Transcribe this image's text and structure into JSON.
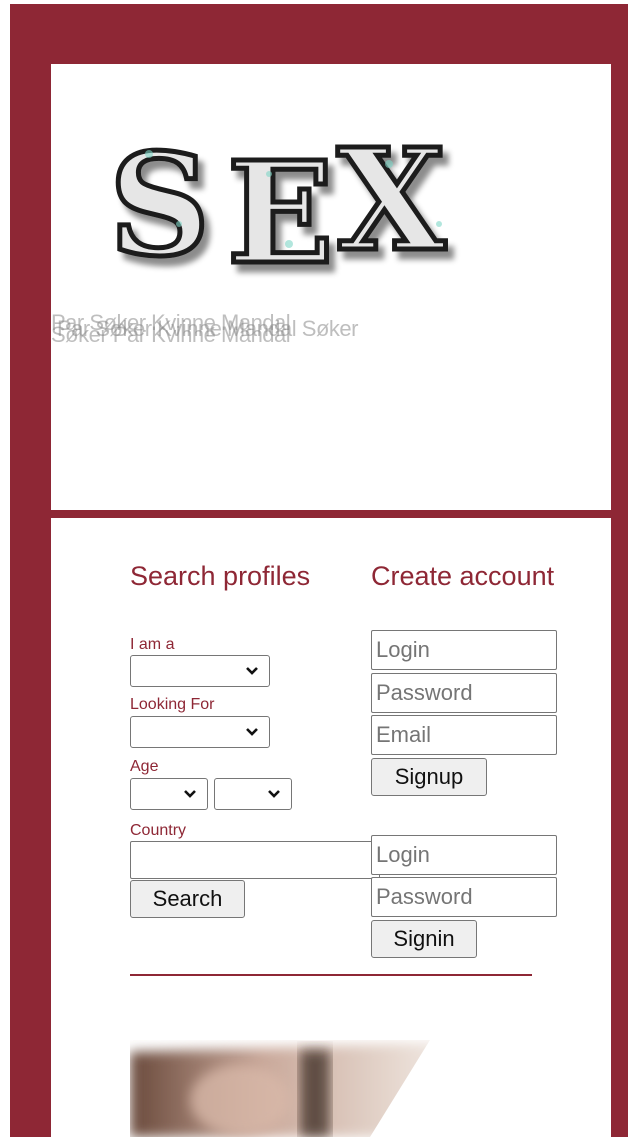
{
  "header": {
    "logo_text": "SEX",
    "ghost_lines": [
      "Par Søker Kvinne Mandal",
      "Søker Par Kvinne Mandal",
      "Par Søker Kvinne Mandal Søker"
    ]
  },
  "search": {
    "title": "Search profiles",
    "i_am_label": "I am a",
    "looking_for_label": "Looking For",
    "age_label": "Age",
    "country_label": "Country",
    "country_value": "",
    "search_button": "Search"
  },
  "create": {
    "title": "Create account",
    "login_placeholder": "Login",
    "password_placeholder": "Password",
    "email_placeholder": "Email",
    "signup_button": "Signup"
  },
  "signin": {
    "login_placeholder": "Login",
    "password_placeholder": "Password",
    "signin_button": "Signin"
  },
  "colors": {
    "brand": "#8e2735",
    "panel": "#ffffff"
  }
}
